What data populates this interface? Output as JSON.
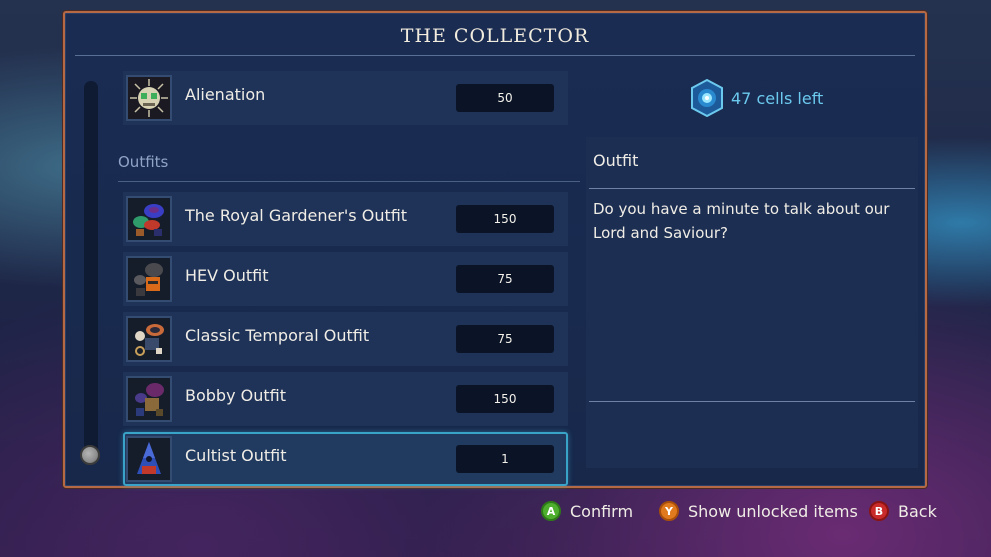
{
  "title": "THE COLLECTOR",
  "list": {
    "top_item": {
      "label": "Alienation",
      "price": "50",
      "icon": "skull-portrait-icon"
    },
    "section_label": "Outfits",
    "items": [
      {
        "label": "The Royal Gardener's Outfit",
        "price": "150",
        "icon": "royal-gardener-outfit-icon"
      },
      {
        "label": "HEV Outfit",
        "price": "75",
        "icon": "hev-outfit-icon"
      },
      {
        "label": "Classic Temporal Outfit",
        "price": "75",
        "icon": "classic-temporal-outfit-icon"
      },
      {
        "label": "Bobby Outfit",
        "price": "150",
        "icon": "bobby-outfit-icon"
      },
      {
        "label": "Cultist Outfit",
        "price": "1",
        "icon": "cultist-outfit-icon",
        "selected": true
      }
    ]
  },
  "cells": {
    "text": "47 cells left",
    "icon": "cell-orb-icon",
    "color": "#6cc9ee"
  },
  "details": {
    "header": "Outfit",
    "description": "Do you have a minute to talk about our Lord and Saviour?"
  },
  "footer": {
    "confirm": {
      "button": "A",
      "label": "Confirm",
      "color": "#4eae2e"
    },
    "show_unlocked": {
      "button": "Y",
      "label": "Show unlocked items",
      "color": "#e07a1e"
    },
    "back": {
      "button": "B",
      "label": "Back",
      "color": "#c92a2a"
    }
  },
  "accent_color": "#3aa3c8"
}
